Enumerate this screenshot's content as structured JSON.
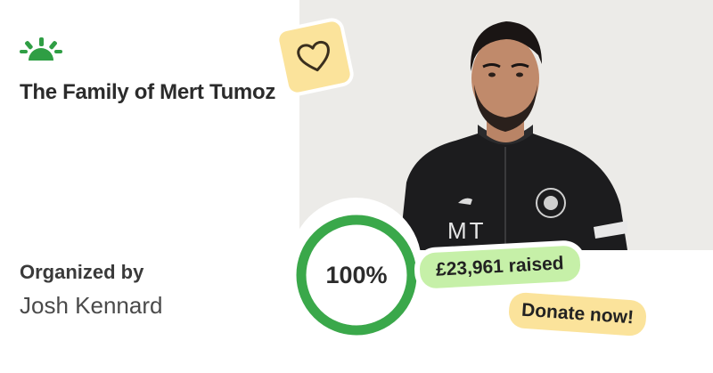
{
  "logo": {
    "icon": "sunburst-icon",
    "color": "#2f9e44"
  },
  "title": "The Family of Mert Tumoz",
  "organizer": {
    "label": "Organized by",
    "name": "Josh Kennard"
  },
  "photo": {
    "shirt_initials": "MT",
    "alt": "Man with dark hair and beard wearing a black training jacket"
  },
  "badge": {
    "icon": "heart-icon"
  },
  "progress": {
    "percent_label": "100%",
    "fraction": 1.0,
    "color": "#3aa84a"
  },
  "raised": {
    "label": "£23,961 raised"
  },
  "donate": {
    "label": "Donate now!"
  },
  "colors": {
    "accent_green": "#3aa84a",
    "raised_bg": "#c6f0a8",
    "donate_bg": "#fbe39b"
  }
}
